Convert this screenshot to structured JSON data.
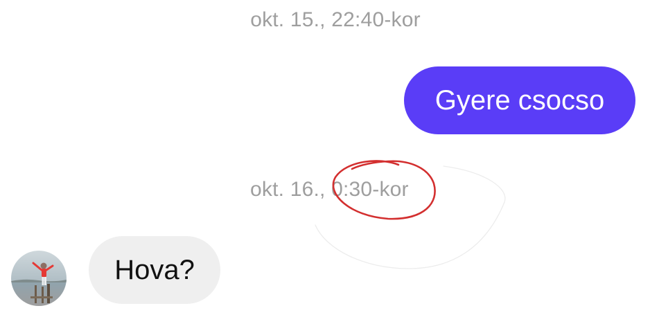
{
  "conversation": {
    "timestamp_1": "okt. 15., 22:40-kor",
    "outgoing_message": "Gyere csocso",
    "timestamp_2_prefix": "okt. 16., ",
    "timestamp_2_time": "0:30-kor",
    "incoming_message": "Hova?"
  },
  "colors": {
    "outgoing_bubble": "#5a3df7",
    "incoming_bubble": "#efefef",
    "timestamp_text": "#9e9e9e",
    "annotation_circle": "#d32f2f"
  },
  "icons": {
    "avatar": "contact-avatar-photo"
  }
}
